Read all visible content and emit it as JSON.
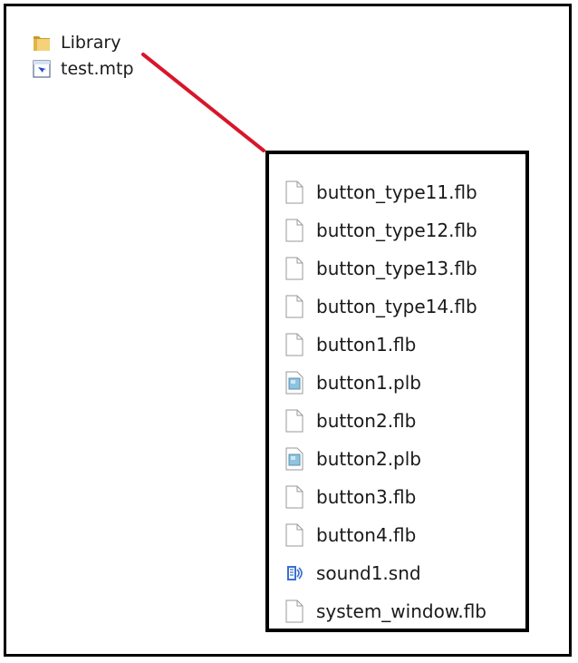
{
  "top_items": [
    {
      "label": "Library",
      "icon": "folder-icon"
    },
    {
      "label": "test.mtp",
      "icon": "mtp-file-icon"
    }
  ],
  "colors": {
    "connector": "#d8162b",
    "folder_light": "#f3d27a",
    "folder_dark": "#c79a2c"
  },
  "library_files": [
    {
      "label": "button_type11.flb",
      "icon": "blank-file-icon"
    },
    {
      "label": "button_type12.flb",
      "icon": "blank-file-icon"
    },
    {
      "label": "button_type13.flb",
      "icon": "blank-file-icon"
    },
    {
      "label": "button_type14.flb",
      "icon": "blank-file-icon"
    },
    {
      "label": "button1.flb",
      "icon": "blank-file-icon"
    },
    {
      "label": "button1.plb",
      "icon": "image-file-icon"
    },
    {
      "label": "button2.flb",
      "icon": "blank-file-icon"
    },
    {
      "label": "button2.plb",
      "icon": "image-file-icon"
    },
    {
      "label": "button3.flb",
      "icon": "blank-file-icon"
    },
    {
      "label": "button4.flb",
      "icon": "blank-file-icon"
    },
    {
      "label": "sound1.snd",
      "icon": "sound-file-icon"
    },
    {
      "label": "system_window.flb",
      "icon": "blank-file-icon"
    }
  ]
}
